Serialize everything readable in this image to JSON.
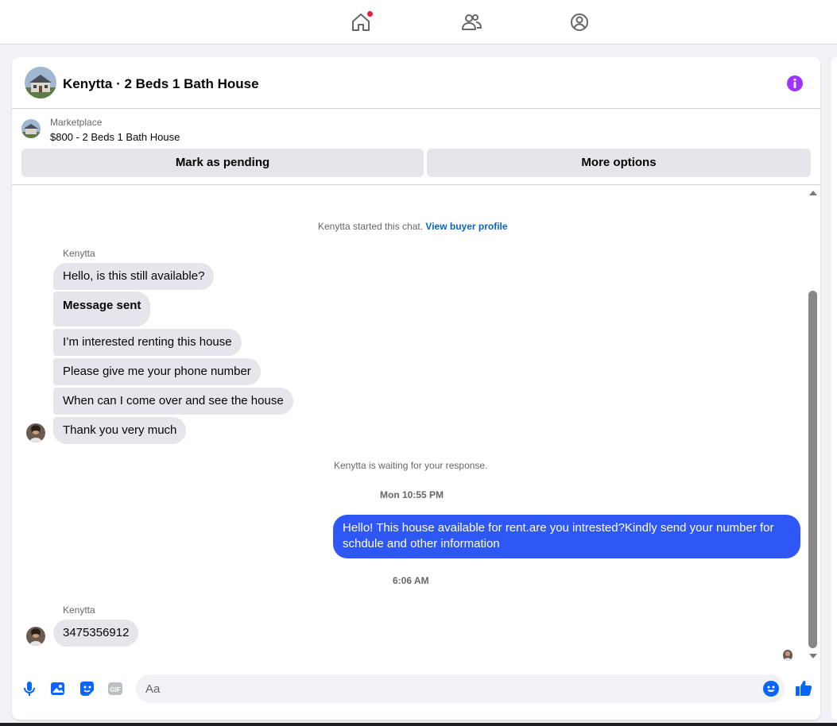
{
  "chat": {
    "title": "Kenytta · 2 Beds 1 Bath House"
  },
  "listing": {
    "label": "Marketplace",
    "price_title": "$800 - 2 Beds 1 Bath House",
    "mark_pending": "Mark as pending",
    "more_options": "More options"
  },
  "messages": {
    "started_text": "Kenytta started this chat.",
    "view_profile": "View buyer profile",
    "sender_name": "Kenytta",
    "incoming": [
      "Hello, is this still available?",
      "Message sent",
      "I’m interested renting this house",
      "Please give me your phone number",
      "When can I come over and see the house",
      "Thank you very much"
    ],
    "waiting_text": "Kenytta is waiting for your response.",
    "time1": "Mon 10:55 PM",
    "outgoing": "Hello! This house available for rent.are you intrested?Kindly send your number for schdule and other information",
    "time2": "6:06 AM",
    "sender_name2": "Kenytta",
    "reply": "3475356912"
  },
  "composer": {
    "placeholder": "Aa"
  },
  "colors": {
    "accent": "#0866ff",
    "outgoing_bubble": "#2f57f5",
    "info": "#a033ff",
    "notification": "#e41e3f"
  }
}
